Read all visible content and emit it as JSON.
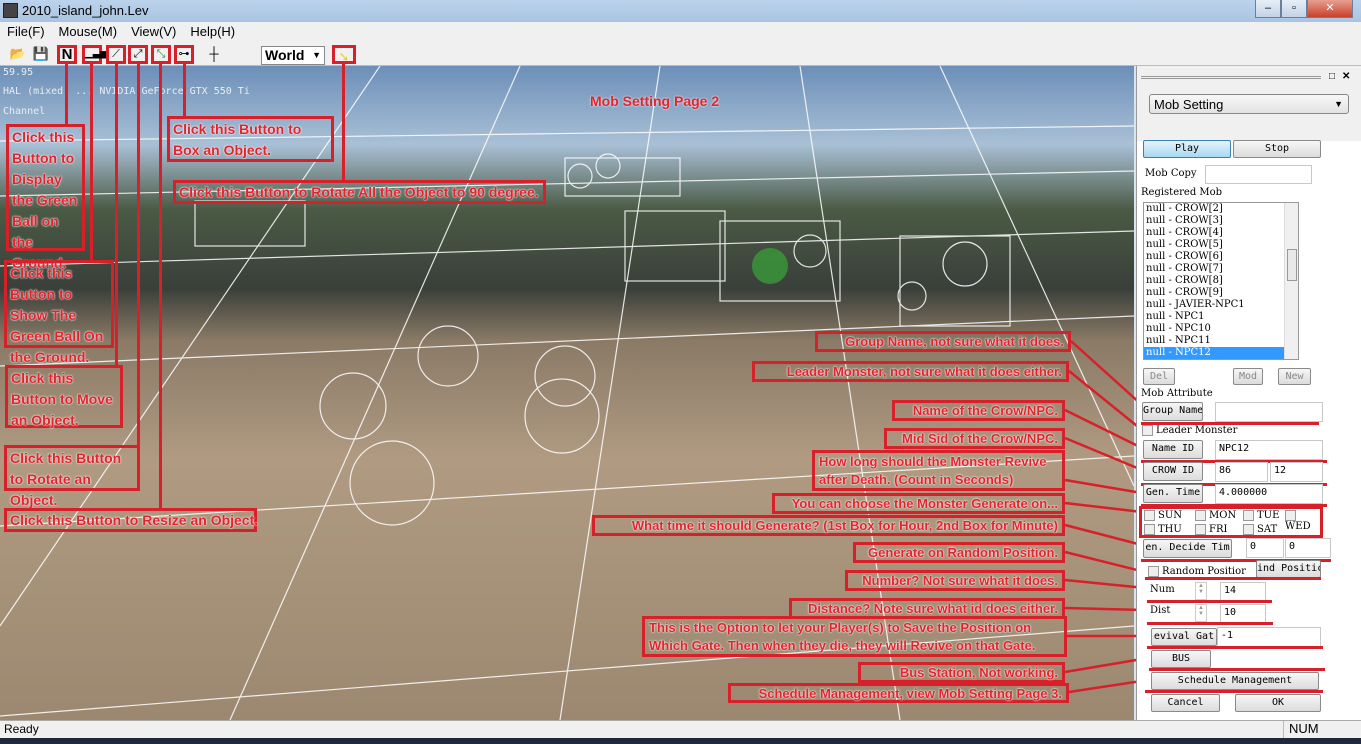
{
  "window": {
    "title": "2010_island_john.Lev"
  },
  "menu": [
    "File(F)",
    "Mouse(M)",
    "View(V)",
    "Help(H)"
  ],
  "toolbar": {
    "world_select": "World",
    "n_label": "N"
  },
  "overlay": {
    "fps": "59.95",
    "renderer": "HAL (mixed) ... NVIDIA GeForce GTX 550 Ti",
    "channel": "Channel",
    "page_label": "Mob Setting Page 2"
  },
  "left_annotations": [
    "Click this Button to Display the Green Ball on the Ground.",
    "Click this Button to Show The Green Ball On the Ground.",
    "Click this Button to Move an Object.",
    "Click this Button to Rotate an Object.",
    "Click this Button to Resize an Object.",
    "Click this Button to Box an Object.",
    "Click this Button to Rotate All the Object to 90 degree."
  ],
  "right_annotations": [
    "Group Name, not sure what it does.",
    "Leader Monster, not sure what it does either.",
    "Name of the Crow/NPC.",
    "Mid Sid of the Crow/NPC.",
    "How long should the Monster Revive after Death. (Count in Seconds)",
    "You can choose the Monster Generate on...",
    "What time it should Generate? (1st Box for Hour, 2nd Box for Minute)",
    "Generate on Random Position.",
    "Number? Not sure what it does.",
    "Distance? Note sure what id does either.",
    "This is the Option to let your Player(s) to Save the Position on Which Gate. Then when they die, they will Revive on that Gate.",
    "Bus Station, Not working.",
    "Schedule Management, view Mob Setting Page 3."
  ],
  "panel": {
    "mode_select": "Mob Setting",
    "play": "Play",
    "stop": "Stop",
    "mob_copy_label": "Mob Copy",
    "mob_copy_value": "",
    "registered_label": "Registered Mob",
    "mobs": [
      "null - CROW[2]",
      "null - CROW[3]",
      "null - CROW[4]",
      "null - CROW[5]",
      "null - CROW[6]",
      "null - CROW[7]",
      "null - CROW[8]",
      "null - CROW[9]",
      "null - JAVIER-NPC1",
      "null - NPC1",
      "null - NPC10",
      "null - NPC11",
      "null - NPC12"
    ],
    "selected_mob": "null - NPC12",
    "del": "Del",
    "mod": "Mod",
    "new": "New",
    "attr_label": "Mob Attribute",
    "group_name_btn": "Group Name",
    "group_name_value": "",
    "leader_monster": "Leader Monster",
    "name_id_btn": "Name ID",
    "name_id_value": "NPC12",
    "crow_id_btn": "CROW ID",
    "crow_id_value1": "86",
    "crow_id_value2": "12",
    "gen_time_btn": "Gen. Time",
    "gen_time_value": "4.000000",
    "days": [
      "SUN",
      "MON",
      "TUE",
      "WED",
      "THU",
      "FRI",
      "SAT"
    ],
    "decide_time_btn": "en. Decide Tim",
    "hour": "0",
    "minute": "0",
    "random_position": "Random Positior",
    "find_position_btn": "ind Positic",
    "num_label": "Num",
    "num_value": "14",
    "dist_label": "Dist",
    "dist_value": "10",
    "revival_gate_btn": "evival Gat",
    "revival_gate_value": "-1",
    "bus_btn": "BUS",
    "schedule_btn": "Schedule Management",
    "cancel": "Cancel",
    "ok": "OK"
  },
  "status": {
    "left": "Ready",
    "right": "NUM"
  },
  "colors": {
    "annotation": "#d8202a",
    "selection": "#3399ff"
  }
}
